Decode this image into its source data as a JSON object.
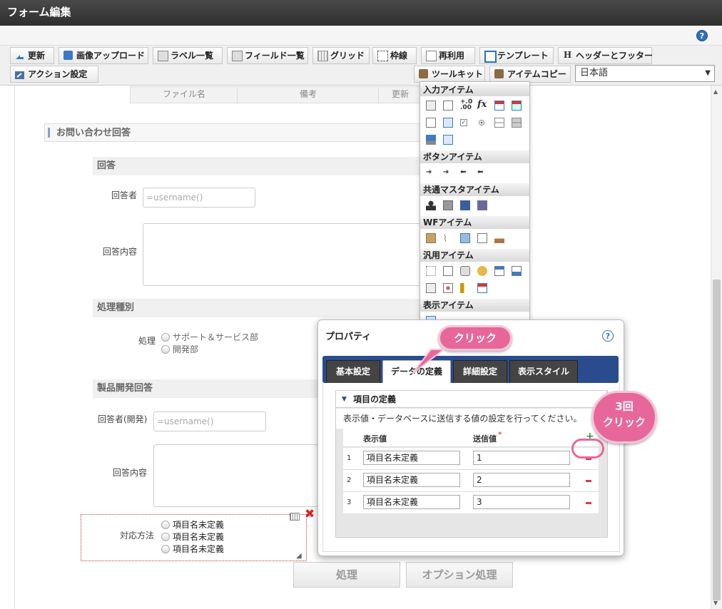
{
  "window": {
    "title": "フォーム編集"
  },
  "toolbar": {
    "row1": [
      {
        "label": "更新",
        "icon": "refresh-icon"
      },
      {
        "label": "画像アップロード",
        "icon": "image-upload-icon"
      },
      {
        "label": "ラベル一覧",
        "icon": "label-list-icon"
      },
      {
        "label": "フィールド一覧",
        "icon": "field-list-icon"
      },
      {
        "label": "グリッド",
        "icon": "grid-icon"
      },
      {
        "label": "枠線",
        "icon": "border-icon"
      },
      {
        "label": "再利用",
        "icon": "reuse-icon"
      },
      {
        "label": "テンプレート",
        "icon": "template-icon"
      },
      {
        "label": "ヘッダーとフッター",
        "icon": "header-footer-icon"
      }
    ],
    "row2": [
      {
        "label": "アクション設定",
        "icon": "action-settings-icon"
      },
      {
        "label": "ツールキット",
        "icon": "toolkit-icon"
      },
      {
        "label": "アイテムコピー",
        "icon": "item-copy-icon"
      }
    ],
    "language": "日本語"
  },
  "form": {
    "table_headers": [
      "ファイル名",
      "備考",
      "更新"
    ],
    "sections": {
      "inquiry": "お問い合わせ回答",
      "answer": "回答",
      "processing": "処理種別",
      "product": "製品開発回答"
    },
    "answerer_label": "回答者",
    "answerer_value": "=username()",
    "answer_content_label": "回答内容",
    "process_label": "処理",
    "process_options": [
      "サポート＆サービス部",
      "開発部"
    ],
    "dev_answerer_label": "回答者(開発)",
    "dev_answerer_value": "=username()",
    "dev_answer_content_label": "回答内容",
    "method_label": "対応方法",
    "method_options": [
      "項目名未定義",
      "項目名未定義",
      "項目名未定義"
    ],
    "buttons": {
      "process": "処理",
      "option_process": "オプション処理"
    }
  },
  "palette": {
    "sections": [
      "入力アイテム",
      "ボタンアイテム",
      "共通マスタアイテム",
      "WFアイテム",
      "汎用アイテム",
      "表示アイテム"
    ]
  },
  "property_dialog": {
    "title": "プロパティ",
    "tabs": [
      "基本設定",
      "データの定義",
      "詳細設定",
      "表示スタイル"
    ],
    "active_tab": "データの定義",
    "panel_title": "項目の定義",
    "description": "表示値・データベースに送信する値の設定を行ってください。",
    "col_display": "表示値",
    "col_send": "送信値",
    "required_mark": "*",
    "rows": [
      {
        "num": "1",
        "display": "項目名未定義",
        "send": "1"
      },
      {
        "num": "2",
        "display": "項目名未定義",
        "send": "2"
      },
      {
        "num": "3",
        "display": "項目名未定義",
        "send": "3"
      }
    ]
  },
  "callouts": {
    "click": "クリック",
    "three_times_line1": "3回",
    "three_times_line2": "クリック"
  }
}
